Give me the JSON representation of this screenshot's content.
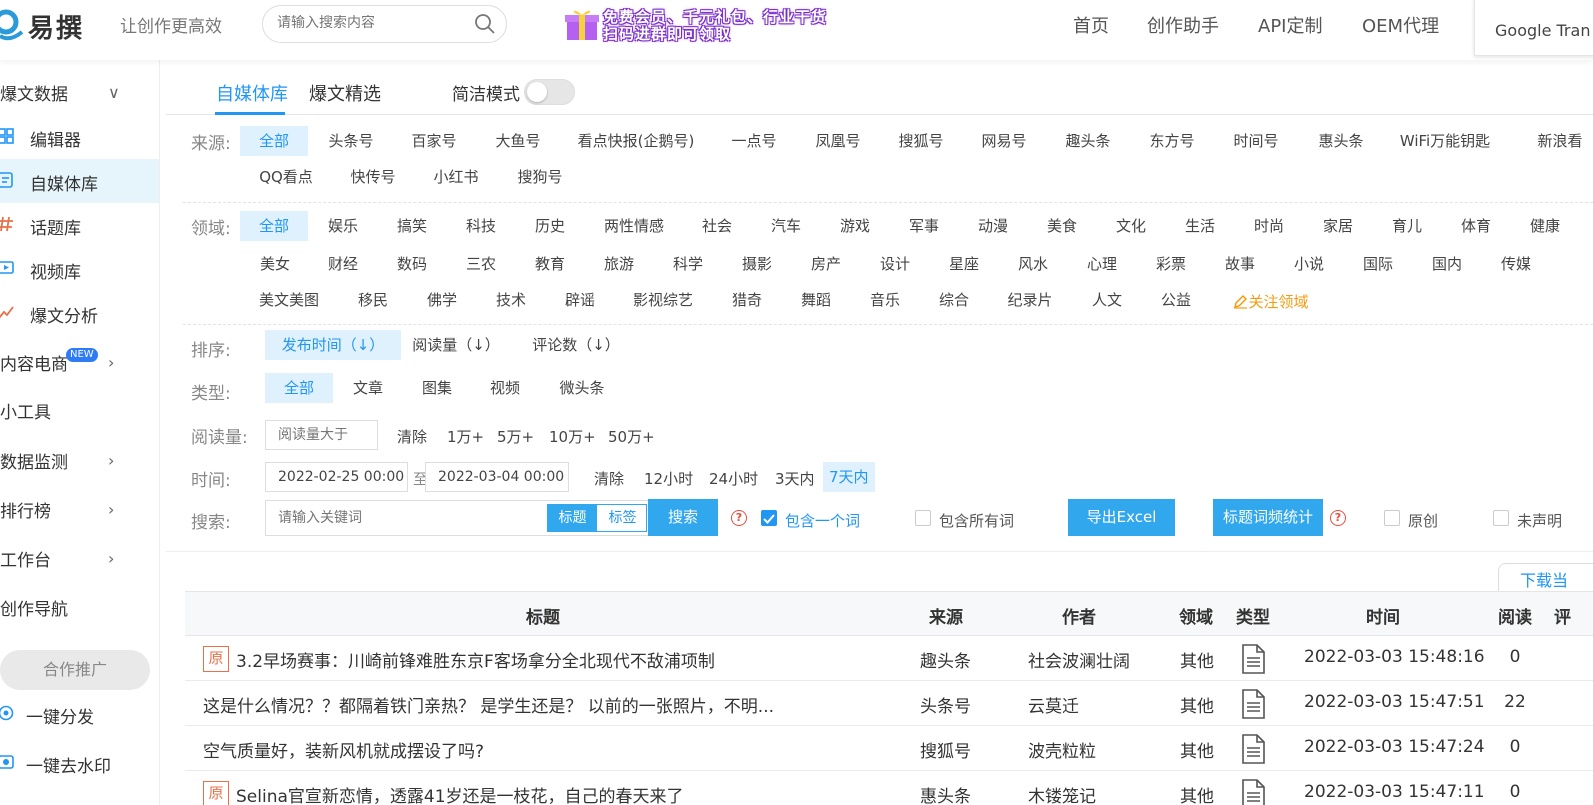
{
  "header": {
    "logo_text": "易撰",
    "slogan": "让创作更高效",
    "search_placeholder": "请输入搜索内容",
    "banner_line1": "免费会员、千元礼包、行业干货",
    "banner_line2": "扫码进群即可领取",
    "nav": [
      "首页",
      "创作助手",
      "API定制",
      "OEM代理"
    ],
    "translate_widget": "Google Tran"
  },
  "sidebar": {
    "items": [
      {
        "label": "爆文数据",
        "icon": "none",
        "chevron": "∨"
      },
      {
        "label": "编辑器",
        "icon": "grid-icon"
      },
      {
        "label": "自媒体库",
        "icon": "list-icon",
        "active": true
      },
      {
        "label": "话题库",
        "icon": "hashtag-icon"
      },
      {
        "label": "视频库",
        "icon": "video-icon"
      },
      {
        "label": "爆文分析",
        "icon": "chart-icon"
      },
      {
        "label": "内容电商",
        "badge": "NEW",
        "chevron": "›"
      },
      {
        "label": "小工具"
      },
      {
        "label": "数据监测",
        "chevron": "›"
      },
      {
        "label": "排行榜",
        "chevron": "›"
      },
      {
        "label": "工作台",
        "chevron": "›"
      },
      {
        "label": "创作导航"
      }
    ],
    "promo_label": "合作推广",
    "tools": [
      {
        "label": "一键分发",
        "icon": "share-icon"
      },
      {
        "label": "一键去水印",
        "icon": "watermark-icon"
      }
    ]
  },
  "tabs": {
    "items": [
      "自媒体库",
      "爆文精选"
    ],
    "active": "自媒体库",
    "mode_label": "简洁模式",
    "mode_on": false
  },
  "filters": {
    "source_label": "来源:",
    "sources_row1": [
      "全部",
      "头条号",
      "百家号",
      "大鱼号",
      "看点快报(企鹅号)",
      "一点号",
      "凤凰号",
      "搜狐号",
      "网易号",
      "趣头条",
      "东方号",
      "时间号",
      "惠头条",
      "WiFi万能钥匙",
      "新浪看"
    ],
    "sources_row2": [
      "QQ看点",
      "快传号",
      "小红书",
      "搜狗号"
    ],
    "domain_label": "领域:",
    "domains_row1": [
      "全部",
      "娱乐",
      "搞笑",
      "科技",
      "历史",
      "两性情感",
      "社会",
      "汽车",
      "游戏",
      "军事",
      "动漫",
      "美食",
      "文化",
      "生活",
      "时尚",
      "家居",
      "育儿",
      "体育",
      "健康"
    ],
    "domains_row2": [
      "美女",
      "财经",
      "数码",
      "三农",
      "教育",
      "旅游",
      "科学",
      "摄影",
      "房产",
      "设计",
      "星座",
      "风水",
      "心理",
      "彩票",
      "故事",
      "小说",
      "国际",
      "国内",
      "传媒"
    ],
    "domains_row3": [
      "美文美图",
      "移民",
      "佛学",
      "技术",
      "辟谣",
      "影视综艺",
      "猎奇",
      "舞蹈",
      "音乐",
      "综合",
      "纪录片",
      "人文",
      "公益"
    ],
    "follow_domain": "关注领域",
    "sort_label": "排序:",
    "sorts": [
      "发布时间（↓）",
      "阅读量（↓）",
      "评论数（↓）"
    ],
    "type_label": "类型:",
    "types": [
      "全部",
      "文章",
      "图集",
      "视频",
      "微头条"
    ],
    "reads_label": "阅读量:",
    "reads_placeholder": "阅读量大于",
    "reads_clear": "清除",
    "reads_options": [
      "1万+",
      "5万+",
      "10万+",
      "50万+"
    ],
    "time_label": "时间:",
    "time_start": "2022-02-25 00:00",
    "time_to": "至",
    "time_end": "2022-03-04 00:00",
    "time_clear": "清除",
    "time_options": [
      "12小时",
      "24小时",
      "3天内",
      "7天内"
    ],
    "search_label": "搜索:",
    "search_placeholder": "请输入关键词",
    "search_scope": [
      "标题",
      "标签"
    ],
    "search_button": "搜索",
    "help_mark": "?",
    "include_any": "包含一个词",
    "include_all": "包含所有词",
    "export_button": "导出Excel",
    "stats_button": "标题词频统计",
    "original": "原创",
    "undeclared": "未声明",
    "download_tab": "下载当"
  },
  "table": {
    "headers": [
      "标题",
      "来源",
      "作者",
      "领域",
      "类型",
      "时间",
      "阅读",
      "评"
    ],
    "original_badge": "原",
    "rows": [
      {
        "title": "3.2早场赛事：川崎前锋难胜东京F客场拿分全北现代不敌浦项制",
        "source": "趣头条",
        "author": "社会波澜壮阔",
        "domain": "其他",
        "time": "2022-03-03 15:48:16",
        "reads": "0",
        "original": true
      },
      {
        "title": "这是什么情况？？都隔着铁门亲热？ 是学生还是？ 以前的一张照片，不明...",
        "source": "头条号",
        "author": "云莫迁",
        "domain": "其他",
        "time": "2022-03-03 15:47:51",
        "reads": "22",
        "original": false
      },
      {
        "title": "空气质量好，装新风机就成摆设了吗?",
        "source": "搜狐号",
        "author": "波壳粒粒",
        "domain": "其他",
        "time": "2022-03-03 15:47:24",
        "reads": "0",
        "original": false
      },
      {
        "title": "Selina官宣新恋情，透露41岁还是一枝花，自己的春天来了",
        "source": "惠头条",
        "author": "木镂笼记",
        "domain": "其他",
        "time": "2022-03-03 15:47:11",
        "reads": "0",
        "original": true
      }
    ]
  },
  "colors": {
    "accent": "#2196f3",
    "button": "#31a7ee",
    "active_bg": "#dff1fc",
    "orange": "#f39c12",
    "help_red": "#e74c3c"
  }
}
